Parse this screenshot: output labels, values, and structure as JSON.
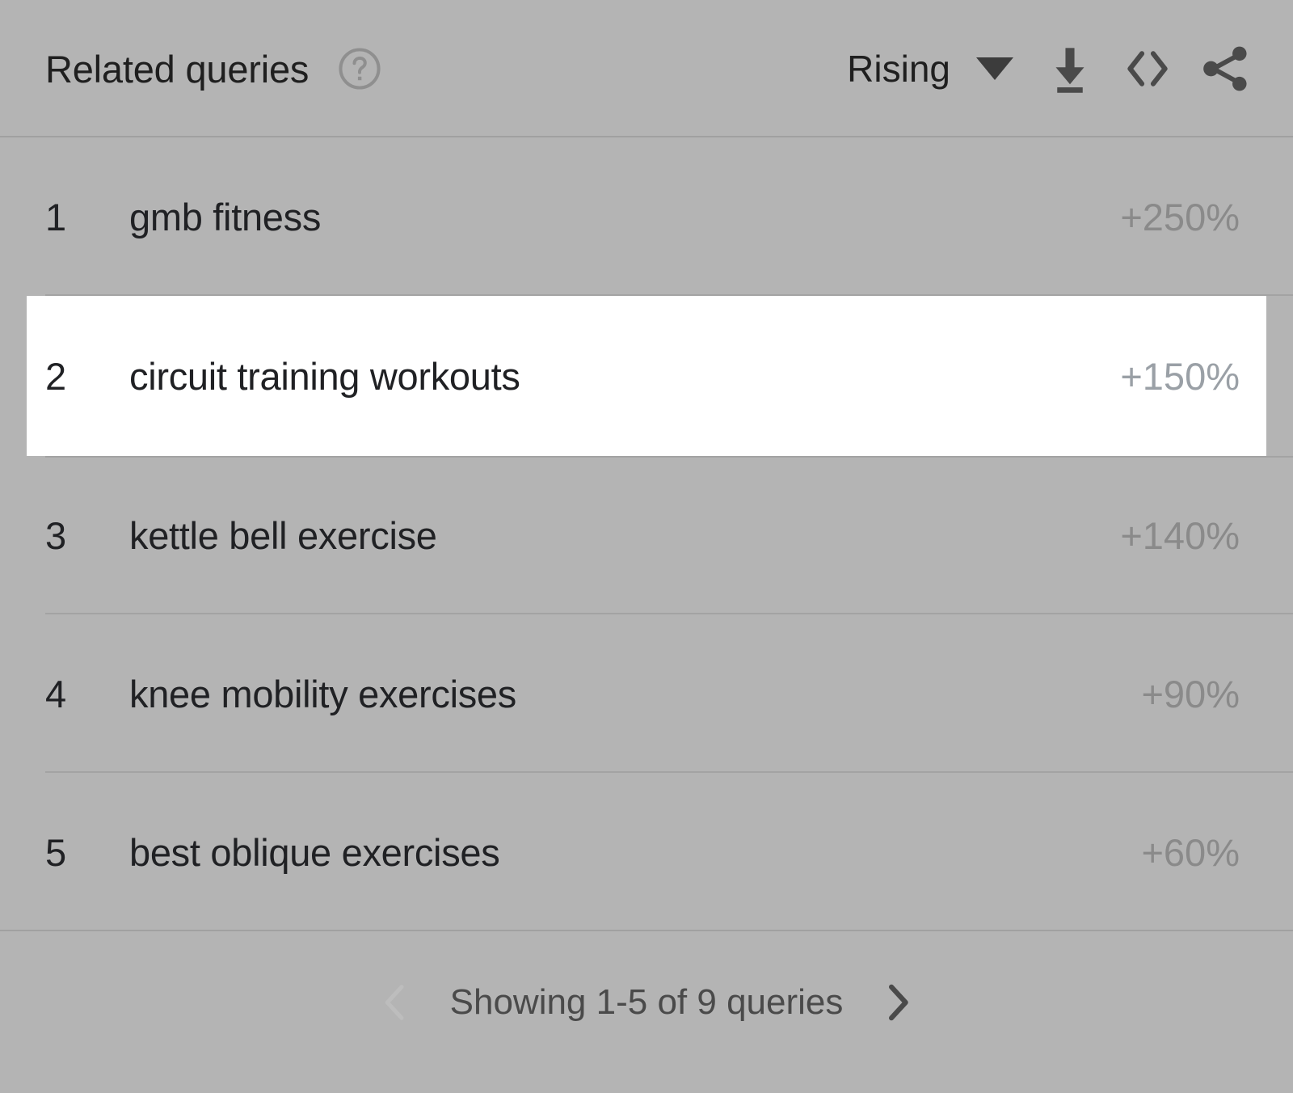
{
  "panel": {
    "title": "Related queries",
    "help_icon": "help-circle-icon"
  },
  "toolbar": {
    "sort_selected": "Rising",
    "sort_caret_icon": "chevron-down-icon",
    "download_icon": "download-icon",
    "embed_icon": "embed-code-icon",
    "share_icon": "share-icon"
  },
  "rows": [
    {
      "rank": "1",
      "query": "gmb fitness",
      "delta": "+250%",
      "highlighted": false
    },
    {
      "rank": "2",
      "query": "circuit training workouts",
      "delta": "+150%",
      "highlighted": true
    },
    {
      "rank": "3",
      "query": "kettle bell exercise",
      "delta": "+140%",
      "highlighted": false
    },
    {
      "rank": "4",
      "query": "knee mobility exercises",
      "delta": "+90%",
      "highlighted": false
    },
    {
      "rank": "5",
      "query": "best oblique exercises",
      "delta": "+60%",
      "highlighted": false
    }
  ],
  "footer": {
    "prev_icon": "chevron-left-icon",
    "next_icon": "chevron-right-icon",
    "status": "Showing 1-5 of 9 queries"
  },
  "colors": {
    "background": "#b4b4b4",
    "highlight_row": "#ffffff",
    "text_primary": "#202124",
    "text_muted": "#8a8a8a",
    "divider": "#a3a3a3"
  }
}
